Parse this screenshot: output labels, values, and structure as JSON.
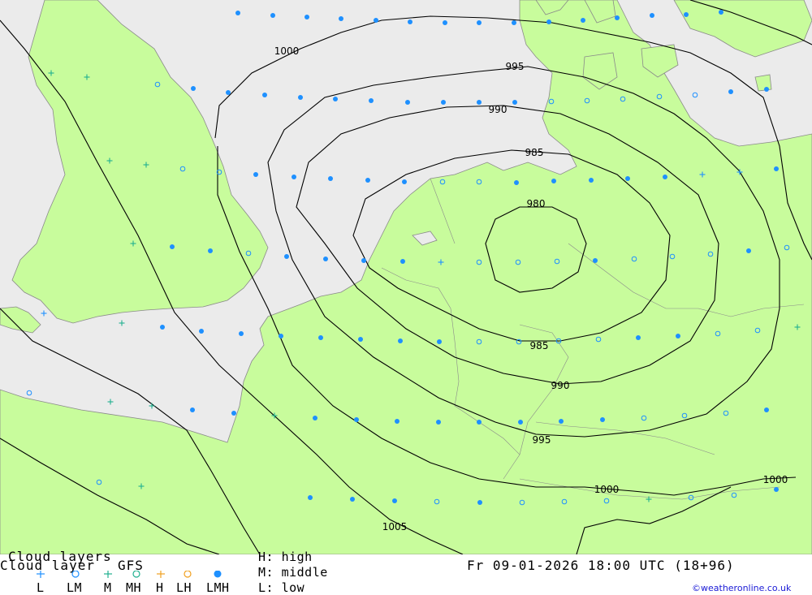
{
  "map": {
    "colors": {
      "sea": "#ebebeb",
      "land": "#c8fc9c",
      "coast": "#8a8a8a",
      "isobar": "#000000",
      "marker": "#1e90ff",
      "marker_h": "#f0a020"
    },
    "isobar_labels": [
      "1000",
      "995",
      "990",
      "985",
      "980",
      "985",
      "990",
      "995",
      "1000",
      "1000",
      "1005"
    ],
    "marker_names": [
      "dot",
      "circle",
      "plus"
    ]
  },
  "legend": {
    "title_top": "Cloud layers",
    "title_bottom": "Cloud layer",
    "model": "GFS",
    "symbols": [
      {
        "label": "L",
        "icon": "plus",
        "color": "#1e90ff"
      },
      {
        "label": "LM",
        "icon": "circle",
        "color": "#1e90ff"
      },
      {
        "label": "M",
        "icon": "plus",
        "color": "#20b090"
      },
      {
        "label": "MH",
        "icon": "circle",
        "color": "#20b090"
      },
      {
        "label": "H",
        "icon": "plus",
        "color": "#f0a020"
      },
      {
        "label": "LH",
        "icon": "circle",
        "color": "#f0a020"
      },
      {
        "label": "LMH",
        "icon": "dot",
        "color": "#1e90ff"
      }
    ],
    "key_h": "H: high",
    "key_m": "M: middle",
    "key_l": "L: low",
    "datetime": "Fr 09-01-2026 18:00 UTC (18+96)",
    "credit": "©weatheronline.co.uk"
  }
}
